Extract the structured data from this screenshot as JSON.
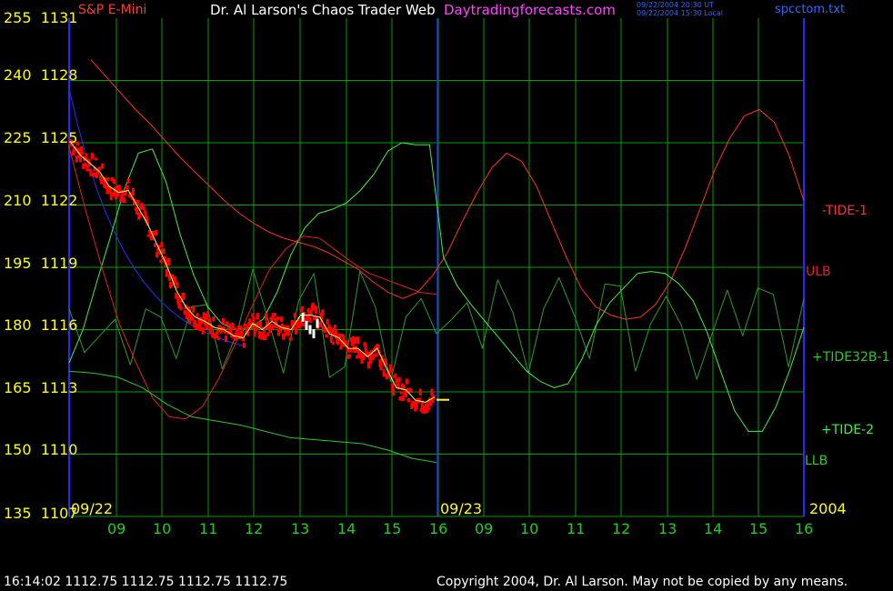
{
  "header": {
    "symbol": "S&P E-Mini",
    "title": "Dr. Al Larson's Chaos Trader Web",
    "site": "Daytradingforecasts.com",
    "ut_line": "09/22/2004 20:30 UT",
    "local_line": "09/22/2004 15:30 Local",
    "file": "spcctom.txt"
  },
  "footer": {
    "quote": "16:14:02  1112.75 1112.75 1112.75 1112.75",
    "copyright": "Copyright 2004, Dr. Al Larson. May not be copied by any means."
  },
  "colors": {
    "background": "#000000",
    "grid": "#00a000",
    "axis": "#2828ff",
    "price": "#ff0000",
    "price_avg": "#ffff66",
    "label_yellow": "#ffff00",
    "title_white": "#ffffff",
    "site_magenta": "#ff44ff",
    "symbol_red": "#ff3b3b",
    "file_blue": "#3366ff",
    "tide1_red": "#ff3030",
    "tide32b_green": "#2f9a2f",
    "tide2_green": "#44ee44",
    "envelope_red": "#e02020",
    "envelope_green": "#2ec52e",
    "blue_curve": "#2a2aff"
  },
  "chart_data": {
    "type": "line",
    "y_left": [
      "255",
      "240",
      "225",
      "210",
      "195",
      "180",
      "165",
      "150",
      "135"
    ],
    "y_right": [
      "1131",
      "1128",
      "1125",
      "1122",
      "1119",
      "1116",
      "1113",
      "1110",
      "1107"
    ],
    "ylim": [
      1107,
      1131
    ],
    "x_ticks": [
      "09",
      "10",
      "11",
      "12",
      "13",
      "14",
      "15",
      "16",
      "09",
      "10",
      "11",
      "12",
      "13",
      "14",
      "15",
      "16"
    ],
    "date_labels": [
      "09/22",
      "09/23"
    ],
    "year": "2004",
    "last_price": 1112.75,
    "series": [
      {
        "name": "-TIDE-1",
        "values": [
          1129,
          1128.2,
          1127.4,
          1126.6,
          1125.9,
          1125.1,
          1124.3,
          1123.6,
          1122.9,
          1122.2,
          1121.6,
          1121.1,
          1120.7,
          1120.4,
          1120.2,
          1120.0,
          1119.7,
          1119.3,
          1118.9,
          1118.3,
          1117.8,
          1117.5,
          1117.8,
          1118.6,
          1119.7,
          1121.2,
          1122.6,
          1123.8,
          1124.5,
          1124.1,
          1122.9,
          1121.2,
          1119.5,
          1118.0,
          1117.1,
          1116.7,
          1116.5,
          1116.6,
          1117.2,
          1118.3,
          1119.9,
          1121.8,
          1123.7,
          1125.2,
          1126.3,
          1126.6,
          1126.0,
          1124.4,
          1122.2
        ]
      },
      {
        "name": "+TIDE32B-1",
        "values": [
          1117,
          1114.9,
          1115.7,
          1116.5,
          1114.3,
          1117.0,
          1116.6,
          1114.6,
          1117.1,
          1117.2,
          1114.1,
          1115.9,
          1118.9,
          1116.5,
          1113.9,
          1117.4,
          1118.7,
          1113.7,
          1114.2,
          1118.8,
          1117.1,
          1113.5,
          1116.6,
          1117.5,
          1115.8,
          1116.5,
          1117.3,
          1115.1,
          1118.4,
          1116.8,
          1113.9,
          1117.0,
          1118.5,
          1116.7,
          1114.6,
          1118.2,
          1118.1,
          1114.0,
          1116.3,
          1117.6,
          1116.2,
          1113.6,
          1115.8,
          1117.9,
          1115.7,
          1118.0,
          1117.7,
          1114.2,
          1117.5
        ]
      },
      {
        "name": "+TIDE-2",
        "values": [
          1114.4,
          1116.0,
          1118.3,
          1120.5,
          1122.8,
          1124.5,
          1124.7,
          1123.1,
          1120.6,
          1118.6,
          1117.1,
          1116.3,
          1116.0,
          1116.1,
          1116.5,
          1117.8,
          1119.6,
          1120.9,
          1121.6,
          1121.8,
          1122.1,
          1122.7,
          1123.5,
          1124.6,
          1125.0,
          1124.9,
          1124.9,
          1119.5,
          1118.1,
          1117.2,
          1116.4,
          1115.6,
          1114.8,
          1114.0,
          1113.5,
          1113.2,
          1113.4,
          1114.6,
          1116.2,
          1117.3,
          1118.0,
          1118.7,
          1118.8,
          1118.7,
          1118.2,
          1117.4,
          1115.9,
          1114.0,
          1112.1,
          1111.1,
          1111.1,
          1112.3,
          1114.1,
          1116.1
        ]
      },
      {
        "name": "ULB",
        "values": [
          1124.8,
          1121.7,
          1118.9,
          1116.3,
          1114.4,
          1112.7,
          1111.8,
          1111.7,
          1112.3,
          1113.7,
          1115.4,
          1117.2,
          1118.9,
          1119.9,
          1120.5,
          1120.4,
          1119.8,
          1119.2,
          1118.7,
          1118.4,
          1118.1,
          1117.8,
          1117.7
        ]
      },
      {
        "name": "LLB",
        "values": [
          1114.0,
          1113.9,
          1113.7,
          1113.2,
          1112.4,
          1111.8,
          1111.6,
          1111.4,
          1111.1,
          1110.8,
          1110.7,
          1110.6,
          1110.5,
          1110.2,
          1109.8,
          1109.6
        ]
      }
    ],
    "price_path": [
      1125.0,
      1124.4,
      1124.0,
      1123.6,
      1122.9,
      1122.6,
      1122.7,
      1121.9,
      1121.1,
      1120.1,
      1119.1,
      1117.9,
      1117.1,
      1116.6,
      1116.4,
      1116.1,
      1116.0,
      1115.7,
      1115.6,
      1116.3,
      1116.0,
      1116.4,
      1116.1,
      1116.0,
      1116.7,
      1116.7,
      1116.6,
      1115.8,
      1115.6,
      1115.1,
      1115.1,
      1114.7,
      1115.1,
      1114.1,
      1113.2,
      1113.1,
      1112.6,
      1112.5,
      1112.75
    ]
  }
}
